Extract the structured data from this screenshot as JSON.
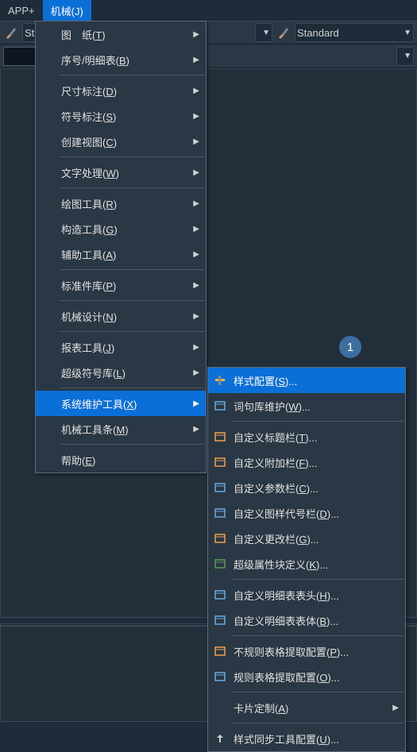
{
  "menubar": {
    "app_plus": "APP+",
    "mechanical": "机械(J)"
  },
  "toolbar": {
    "left_text": "Sta",
    "standard": "Standard"
  },
  "main_menu": {
    "items": [
      {
        "label": "图　纸(T)",
        "arrow": true
      },
      {
        "label": "序号/明细表(B)",
        "arrow": true
      },
      {
        "label": "尺寸标注(D)",
        "arrow": true
      },
      {
        "label": "符号标注(S)",
        "arrow": true
      },
      {
        "label": "创建视图(C)",
        "arrow": true
      },
      {
        "label": "文字处理(W)",
        "arrow": true
      },
      {
        "label": "绘图工具(R)",
        "arrow": true
      },
      {
        "label": "构造工具(G)",
        "arrow": true
      },
      {
        "label": "辅助工具(A)",
        "arrow": true
      },
      {
        "label": "标准件库(P)",
        "arrow": true
      },
      {
        "label": "机械设计(N)",
        "arrow": true
      },
      {
        "label": "报表工具(J)",
        "arrow": true
      },
      {
        "label": "超级符号库(L)",
        "arrow": true
      },
      {
        "label": "系统维护工具(X)",
        "arrow": true,
        "highlight": true
      },
      {
        "label": "机械工具条(M)",
        "arrow": true
      },
      {
        "label": "帮助(E)",
        "arrow": false
      }
    ]
  },
  "sub_menu": {
    "items": [
      {
        "label": "样式配置(S)...",
        "highlight": true,
        "icon": "tools"
      },
      {
        "label": "词句库维护(W)...",
        "icon": "dict"
      },
      {
        "label": "自定义标题栏(T)...",
        "icon": "title"
      },
      {
        "label": "自定义附加栏(F)...",
        "icon": "attach"
      },
      {
        "label": "自定义参数栏(C)...",
        "icon": "param"
      },
      {
        "label": "自定义图样代号栏(D)...",
        "icon": "code"
      },
      {
        "label": "自定义更改栏(G)...",
        "icon": "change"
      },
      {
        "label": "超级属性块定义(K)...",
        "icon": "block"
      },
      {
        "label": "自定义明细表表头(H)...",
        "icon": "header"
      },
      {
        "label": "自定义明细表表体(B)...",
        "icon": "body"
      },
      {
        "label": "不规则表格提取配置(P)...",
        "icon": "extract1"
      },
      {
        "label": "规则表格提取配置(O)...",
        "icon": "extract2"
      },
      {
        "label": "卡片定制(A)",
        "arrow": true
      },
      {
        "label": "样式同步工具配置(U)...",
        "icon": "sync"
      }
    ]
  },
  "callout": "1"
}
